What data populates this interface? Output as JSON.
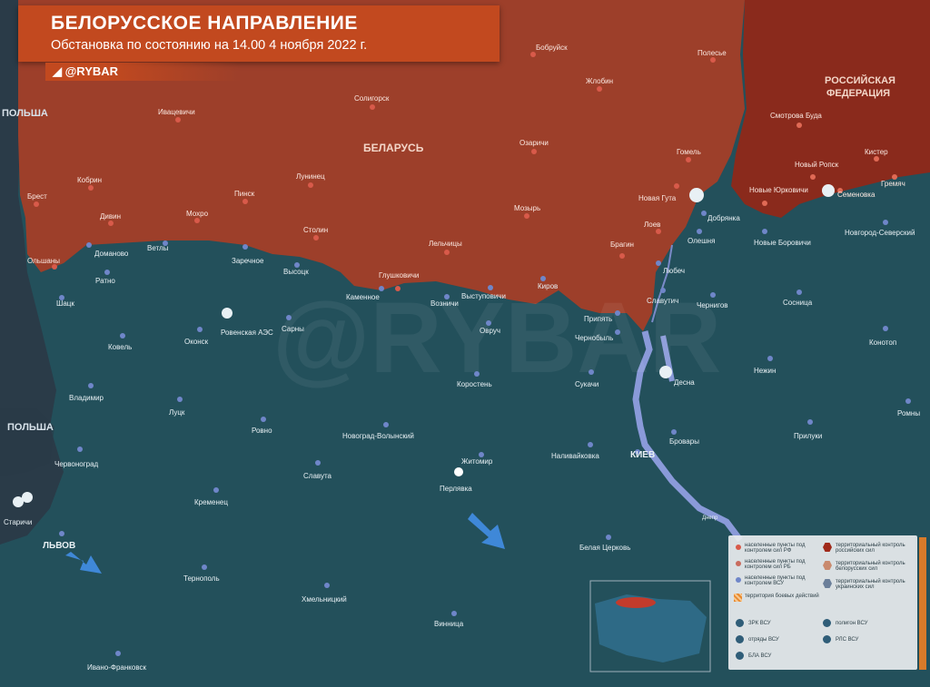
{
  "header": {
    "title": "БЕЛОРУССКОЕ НАПРАВЛЕНИЕ",
    "subtitle": "Обстановка по состоянию на 14.00 4 ноября 2022 г.",
    "brand": "◢ @RYBAR"
  },
  "watermark": "@RYBAR",
  "colors": {
    "ukraine": "#23505b",
    "belarus": "#9d3f2a",
    "russia": "#8a2a1c",
    "poland": "#2a3b48",
    "river": "#8a9ad9",
    "accent": "#c2491f"
  },
  "countries": {
    "belarus": "БЕЛАРУСЬ",
    "russia_1": "РОССИЙСКАЯ",
    "russia_2": "ФЕДЕРАЦИЯ",
    "poland_top": "ПОЛЬША",
    "poland_bottom": "ПОЛЬША"
  },
  "cities_ukraine": {
    "kiev": "КИЕВ",
    "lvov": "ЛЬВОВ",
    "shatsk": "Шацк",
    "ratno": "Ратно",
    "domanovo": "Доманово",
    "vetly": "Ветлы",
    "zarechnoe": "Заречное",
    "vysotsk": "Высоцк",
    "kamennoe": "Каменное",
    "voznichi": "Возничи",
    "vystupovichi": "Выступовичи",
    "kirov": "Киров",
    "pripyat": "Припять",
    "chernobyl": "Чернобыль",
    "ovruch": "Овруч",
    "korosten": "Коростень",
    "sukachi": "Сукачи",
    "slavutich": "Славутич",
    "chernigov": "Чернигов",
    "lyubech": "Любеч",
    "olishevka": "Олешня",
    "dobryanka": "Добрянка",
    "novye_borovichi": "Новые Боровичи",
    "novgorod_severskiy": "Новгород-Северский",
    "sosnitsa": "Сосница",
    "konotop": "Конотоп",
    "nezhin": "Нежин",
    "desna": "Десна",
    "romny": "Ромны",
    "priluki": "Прилуки",
    "brovary": "Бровары",
    "nalivaykovka": "Наливайковка",
    "zhitomir": "Житомир",
    "perlyavka": "Перлявка",
    "belaya_tserkov": "Белая Церковь",
    "vinnitsa": "Винница",
    "khmelnitskiy": "Хмельницкий",
    "ternopol": "Тернополь",
    "ivano_frankovsk": "Ивано-Франковск",
    "kremenets": "Кременец",
    "slavuta": "Славута",
    "novograd_volynskiy": "Новоград-Волынский",
    "rovno": "Ровно",
    "lutsk": "Луцк",
    "kovel": "Ковель",
    "okonsk": "Оконск",
    "rovenskaya_aes": "Ровенская АЭС",
    "sarny": "Сарны",
    "vladimir": "Владимир",
    "chervonograd": "Червоноград",
    "starichi": "Старичи",
    "dnepr": "Днепр"
  },
  "cities_belarus": {
    "bobruysk": "Бобруйск",
    "zhlobin": "Жлобин",
    "polese": "Полесье",
    "soligorsk": "Солигорск",
    "ivatsevichi": "Ивацевичи",
    "kobrin": "Кобрин",
    "brest": "Брест",
    "divin": "Дивин",
    "olshany": "Ольшаны",
    "mokhro": "Мохро",
    "pinsk": "Пинск",
    "luninets": "Лунинец",
    "stolin": "Столин",
    "lelchitsy": "Лельчицы",
    "glushkovichi": "Глушковичи",
    "mozyr": "Мозырь",
    "ozarichi": "Озаричи",
    "gomel": "Гомель",
    "novaya_guta": "Новая Гута",
    "loev": "Лоев",
    "bragin": "Брагин"
  },
  "cities_russia": {
    "smotrova_buda": "Смотрова Буда",
    "novye_yurkovichi": "Новые Юрковичи",
    "novy_ropsk": "Новый Ропск",
    "kister": "Кистер",
    "semenovka": "Семеновка",
    "gremyach": "Гремяч"
  },
  "legend": {
    "item1": "населенные пункты под контролем сил РФ",
    "item2": "населенные пункты под контролем сил РБ",
    "item3": "населенные пункты под контролем ВСУ",
    "item4": "территория боевых действий",
    "item5": "территориальный контроль российских сил",
    "item6": "территориальный контроль белорусских сил",
    "item7": "территориальный контроль украинских сил",
    "zrk": "ЗРК ВСУ",
    "otryady": "отряды ВСУ",
    "bla": "БЛА ВСУ",
    "poligon": "полигон ВСУ",
    "rsz": "РЛС ВСУ"
  }
}
